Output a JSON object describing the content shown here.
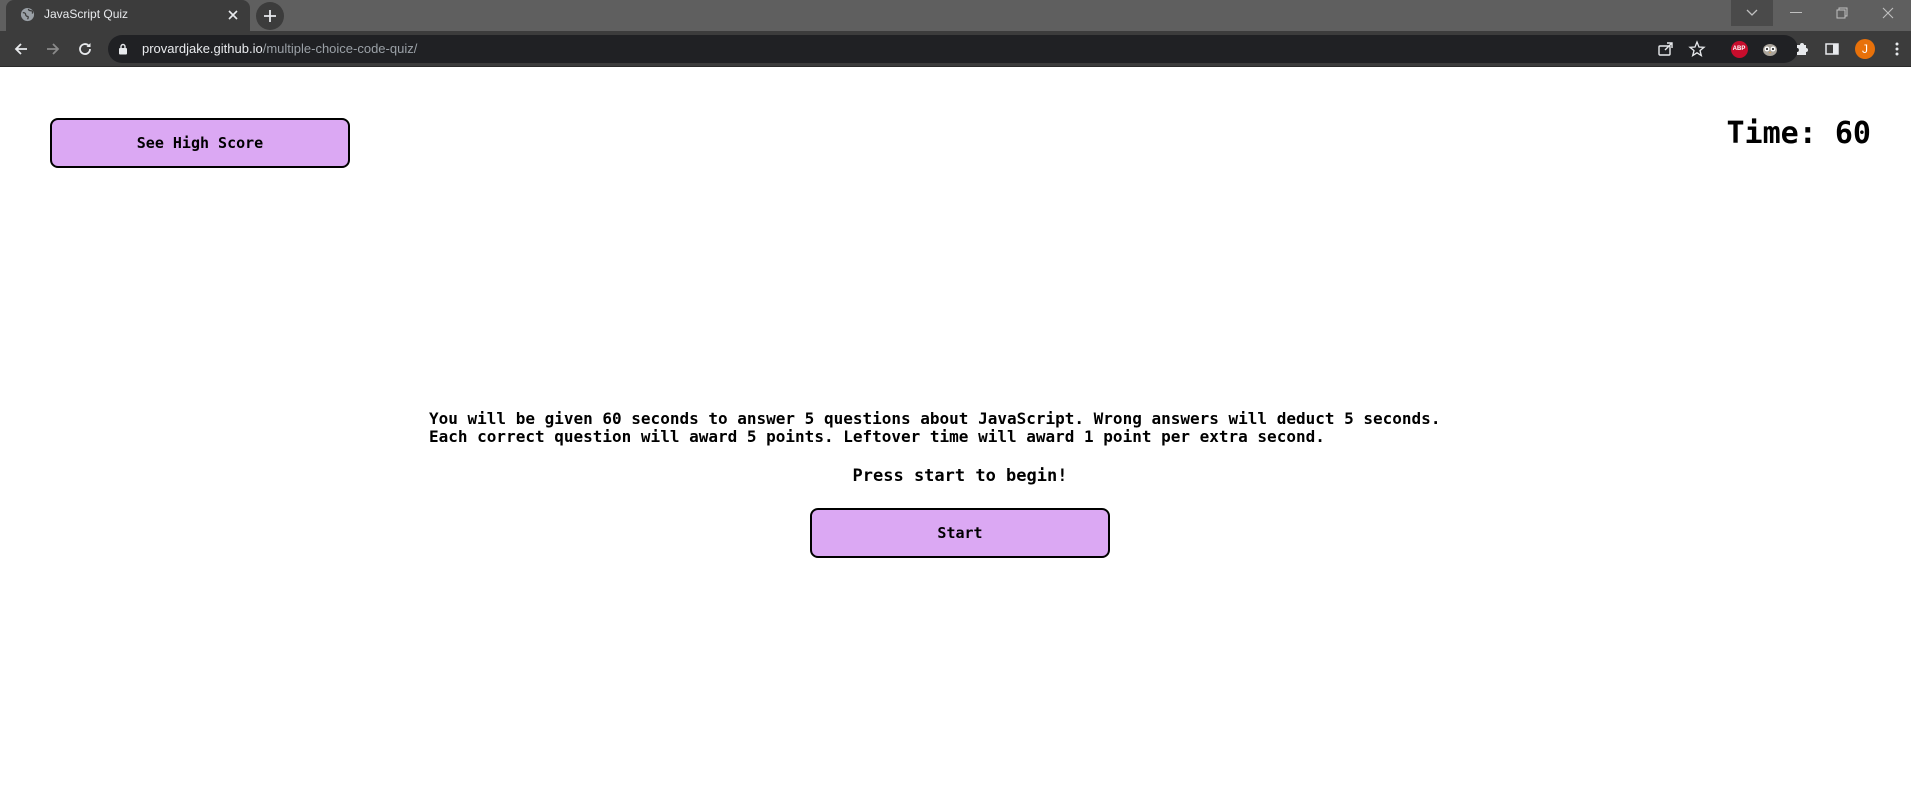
{
  "browser": {
    "tab_title": "JavaScript Quiz",
    "url_host": "provardjake.github.io",
    "url_path": "/multiple-choice-code-quiz/",
    "profile_initial": "J",
    "abp_label": "ABP"
  },
  "quiz": {
    "high_score_label": "See High Score",
    "timer_text": "Time: 60",
    "instructions_line1": "You will be given 60 seconds to answer 5 questions about JavaScript. Wrong answers will deduct 5 seconds.",
    "instructions_line2": "Each correct question will award 5 points. Leftover time will award 1 point per extra second.",
    "press_start_text": "Press start to begin!",
    "start_label": "Start"
  },
  "colors": {
    "button_bg": "#dba8f3",
    "chrome_dark": "#3c3c3c",
    "omnibox_bg": "#202124"
  }
}
